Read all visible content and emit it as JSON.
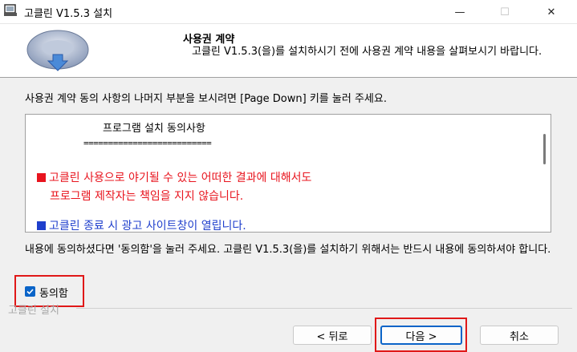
{
  "window": {
    "title": "고클린 V1.5.3 설치",
    "minimize_glyph": "—",
    "maximize_glyph": "☐",
    "close_glyph": "✕"
  },
  "header": {
    "title": "사용권 계약",
    "subtitle": "고클린 V1.5.3(을)를 설치하시기 전에 사용권 계약 내용을 살펴보시기 바랍니다."
  },
  "instruction": "사용권 계약 동의 사항의 나머지 부분을 보시려면 [Page Down] 키를 눌러 주세요.",
  "license": {
    "title": "프로그램 설치 동의사항",
    "separator": "==========================",
    "item1_line1": "고클린 사용으로 야기될 수 있는 어떠한 결과에 대해서도",
    "item1_line2": "프로그램 제작자는 책임을 지지 않습니다.",
    "item2": "고클린 종료 시 광고 사이트창이 열립니다."
  },
  "agree_text": "내용에 동의하셨다면 '동의함'을 눌러 주세요. 고클린 V1.5.3(을)를 설치하기 위해서는 반드시 내용에 동의하셔야 합니다.",
  "checkbox": {
    "label": "동의함",
    "checked": true
  },
  "installer_label": "고클린 설치",
  "buttons": {
    "back": "< 뒤로",
    "next": "다음 >",
    "cancel": "취소"
  },
  "colors": {
    "accent": "#0a64c8",
    "highlight": "#e01818",
    "license_red": "#e8141e",
    "license_blue": "#1f3fcc"
  }
}
